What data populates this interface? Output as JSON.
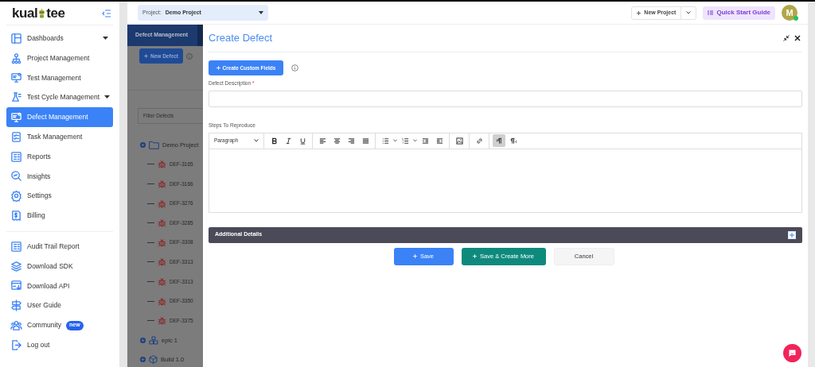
{
  "logo": {
    "parts": [
      "kual",
      "tee"
    ]
  },
  "sidebar": {
    "sections": [
      [
        {
          "label": "Dashboards",
          "kind": "group",
          "selected": false
        },
        {
          "label": "Project Management",
          "kind": "link",
          "selected": false
        },
        {
          "label": "Test Management",
          "kind": "link",
          "selected": false
        },
        {
          "label": "Test Cycle Management",
          "kind": "group",
          "selected": false
        },
        {
          "label": "Defect Management",
          "kind": "link",
          "selected": true
        },
        {
          "label": "Task Management",
          "kind": "link",
          "selected": false
        },
        {
          "label": "Reports",
          "kind": "link",
          "selected": false
        },
        {
          "label": "Insights",
          "kind": "link",
          "selected": false
        },
        {
          "label": "Settings",
          "kind": "link",
          "selected": false
        },
        {
          "label": "Billing",
          "kind": "link",
          "selected": false
        }
      ],
      [
        {
          "label": "Audit Trail Report",
          "kind": "link",
          "selected": false
        },
        {
          "label": "Download SDK",
          "kind": "link",
          "selected": false
        },
        {
          "label": "Download API",
          "kind": "link",
          "selected": false
        },
        {
          "label": "User Guide",
          "kind": "link",
          "selected": false
        },
        {
          "label": "Community",
          "kind": "link",
          "selected": false,
          "badge": "new"
        },
        {
          "label": "Log out",
          "kind": "link",
          "selected": false
        }
      ]
    ]
  },
  "topbar": {
    "project_label": "Project:",
    "project": "Demo Project",
    "new_project": "New Project",
    "quick_start": "Quick Start Guide",
    "avatar": "M",
    "online": true
  },
  "background": {
    "tab": "Defect Management",
    "new_defect": "New Defect",
    "filter_placeholder": "Filter Defects",
    "tree": [
      {
        "label": "Demo Project",
        "kind": "folder",
        "children": [
          {
            "label": "DEF-3165",
            "kind": "defect"
          },
          {
            "label": "DEF-3166",
            "kind": "defect"
          },
          {
            "label": "DEF-3276",
            "kind": "defect"
          },
          {
            "label": "DEF-3285",
            "kind": "defect"
          },
          {
            "label": "DEF-3308",
            "kind": "defect"
          },
          {
            "label": "DEF-3313",
            "kind": "defect"
          },
          {
            "label": "DEF-3313",
            "kind": "defect"
          },
          {
            "label": "DEF-3350",
            "kind": "defect"
          },
          {
            "label": "DEF-3375",
            "kind": "defect"
          }
        ]
      },
      {
        "label": "epic 1",
        "kind": "epic"
      },
      {
        "label": "Build 1.0",
        "kind": "build"
      }
    ]
  },
  "modal": {
    "title": "Create Defect",
    "custom_fields_button": "Create Custom Fields",
    "description": {
      "label": "Defect Description",
      "required_mark": "*"
    },
    "steps": {
      "label": "Steps To Reproduce",
      "block_format": "Paragraph",
      "toolbar": [
        [
          {
            "kind": "bold",
            "on": false
          },
          {
            "kind": "italic",
            "on": false
          },
          {
            "kind": "underline",
            "on": false
          }
        ],
        [
          {
            "kind": "align-left",
            "on": false
          },
          {
            "kind": "align-center",
            "on": false
          },
          {
            "kind": "align-right",
            "on": false
          },
          {
            "kind": "justify",
            "on": false
          }
        ],
        [
          {
            "kind": "bullets",
            "on": false
          },
          {
            "kind": "numbers",
            "on": false
          },
          {
            "kind": "outdent",
            "on": false
          },
          {
            "kind": "indent",
            "on": false
          }
        ],
        [
          {
            "kind": "image",
            "on": false
          }
        ],
        [
          {
            "kind": "link",
            "on": false
          }
        ],
        [
          {
            "kind": "ltr",
            "on": true
          },
          {
            "kind": "rtl",
            "on": false
          }
        ]
      ]
    },
    "additional_details": {
      "label": "Additional Details",
      "expanded": false
    },
    "buttons": [
      {
        "label": "Save",
        "kind": "primary"
      },
      {
        "label": "Save & Create More",
        "kind": "success"
      },
      {
        "label": "Cancel",
        "kind": "secondary"
      }
    ]
  }
}
